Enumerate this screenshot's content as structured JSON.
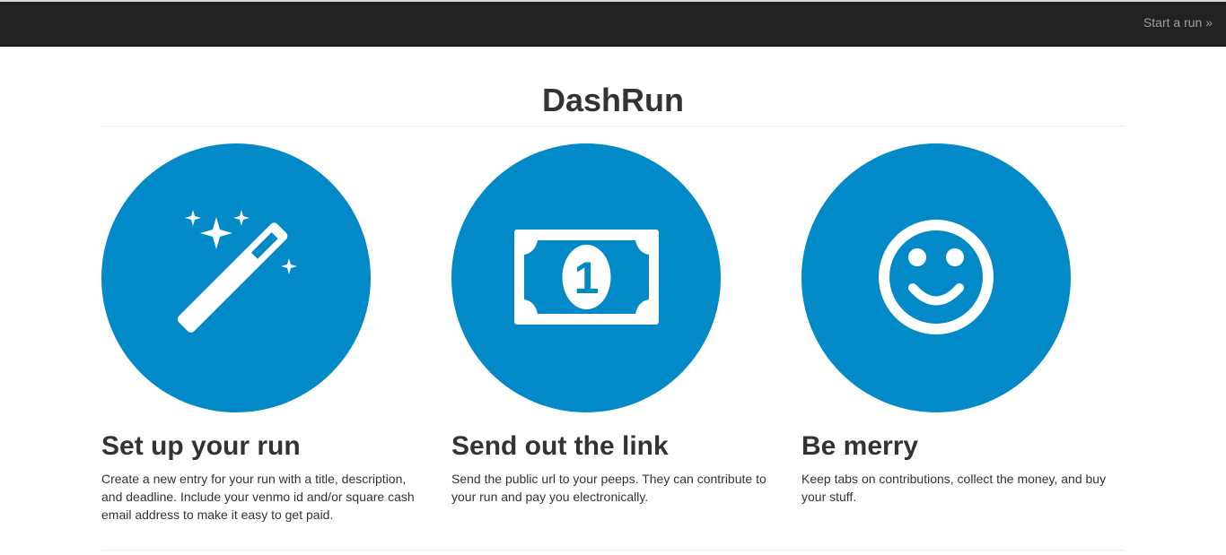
{
  "nav": {
    "start_link": "Start a run »"
  },
  "page": {
    "title": "DashRun"
  },
  "features": [
    {
      "icon": "magic-wand-icon",
      "heading": "Set up your run",
      "text": "Create a new entry for your run with a title, description, and deadline. Include your venmo id and/or square cash email address to make it easy to get paid."
    },
    {
      "icon": "dollar-bill-icon",
      "heading": "Send out the link",
      "text": "Send the public url to your peeps. They can contribute to your run and pay you electronically."
    },
    {
      "icon": "smiley-face-icon",
      "heading": "Be merry",
      "text": "Keep tabs on contributions, collect the money, and buy your stuff."
    }
  ],
  "bill_denomination": "1",
  "colors": {
    "navbar": "#222222",
    "accent": "#0189c8",
    "text": "#333333",
    "nav_link": "#9d9d9d"
  }
}
